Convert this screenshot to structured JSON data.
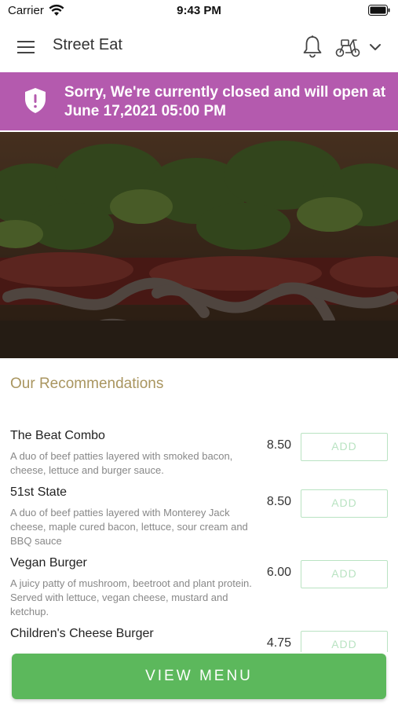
{
  "status_bar": {
    "carrier": "Carrier",
    "time": "9:43 PM",
    "icons": [
      "wifi-icon",
      "battery-icon"
    ]
  },
  "app_bar": {
    "title": "Street Eat",
    "icons": [
      "menu-icon",
      "bell-icon",
      "scooter-icon",
      "chevron-down-icon"
    ]
  },
  "closed_banner": {
    "message": "Sorry, We're currently closed and will open at June 17,2021 05:00 PM",
    "icon": "shield-alert-icon",
    "color": "#b45aae"
  },
  "recommendations": {
    "title": "Our Recommendations",
    "items": [
      {
        "name": "The Beat Combo",
        "description": "A duo of beef patties layered with smoked bacon, cheese, lettuce and burger sauce.",
        "price": "8.50",
        "action": "ADD"
      },
      {
        "name": "51st State",
        "description": "A duo of beef patties layered with Monterey Jack cheese, maple cured bacon, lettuce, sour cream and BBQ sauce",
        "price": "8.50",
        "action": "ADD"
      },
      {
        "name": "Vegan Burger",
        "description": "A juicy patty of mushroom, beetroot and plant protein. Served with lettuce, vegan cheese, mustard and ketchup.",
        "price": "6.00",
        "action": "ADD"
      },
      {
        "name": "Children's Cheese Burger",
        "description": "",
        "price": "4.75",
        "action": "ADD"
      }
    ]
  },
  "footer": {
    "view_menu_label": "VIEW MENU",
    "color": "#5cb85c"
  }
}
